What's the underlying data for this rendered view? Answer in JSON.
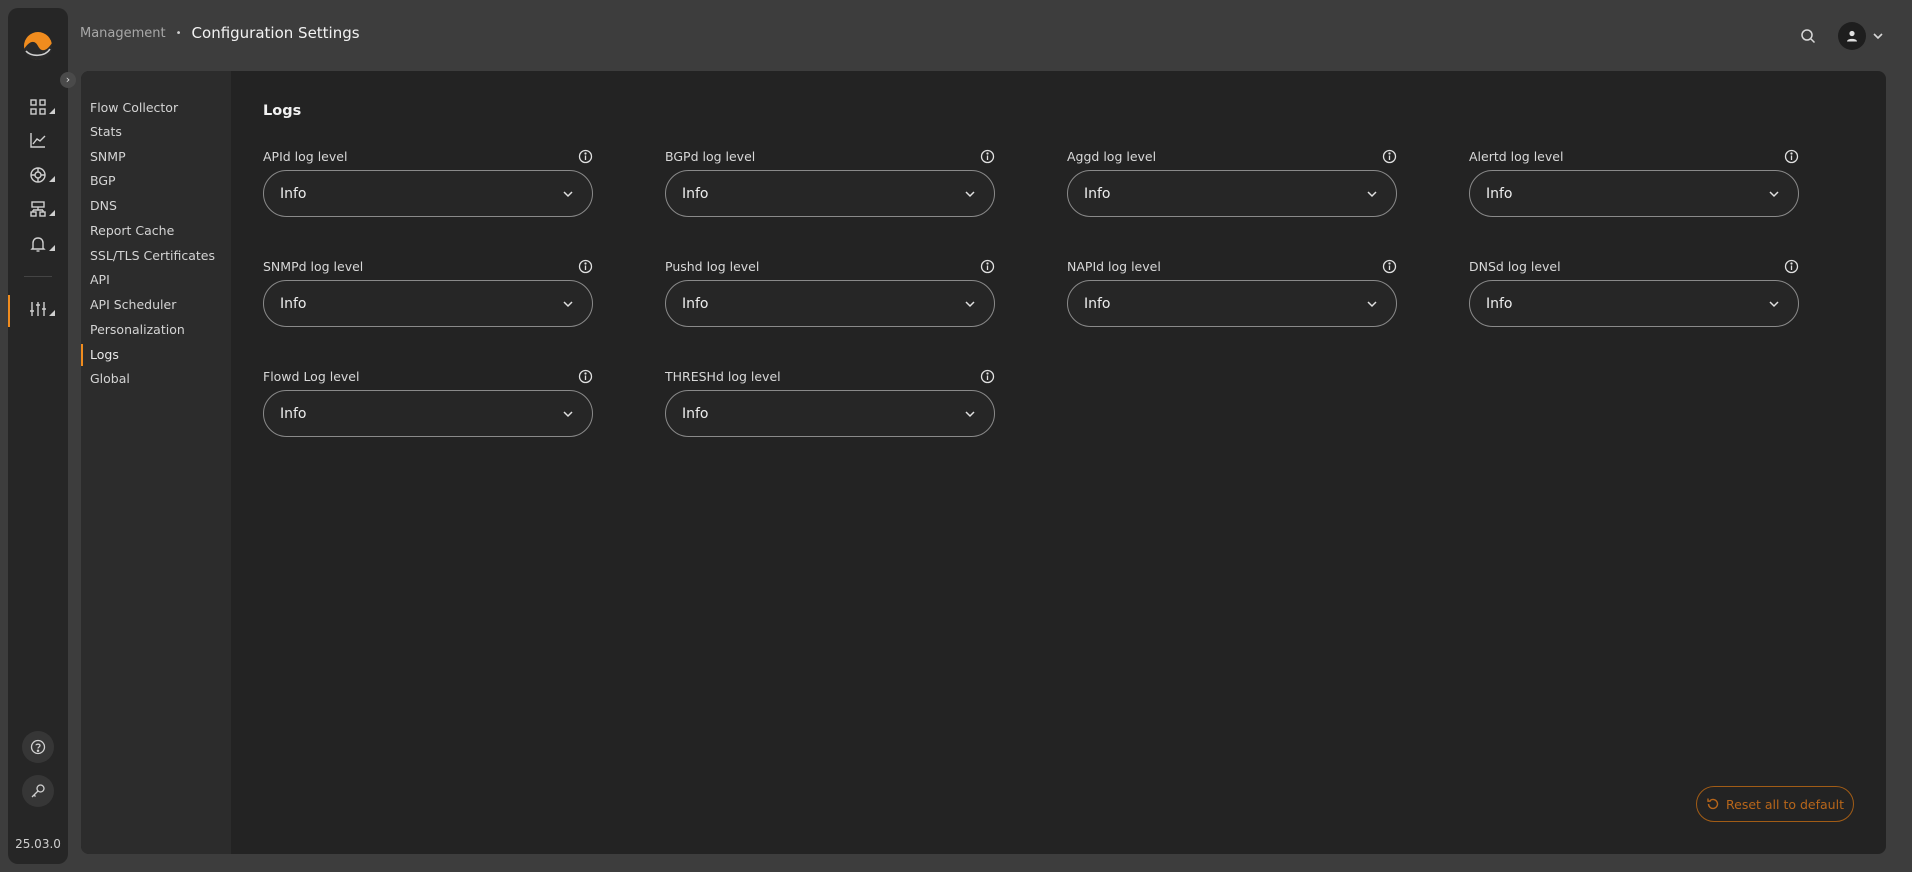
{
  "app": {
    "version": "25.03.0",
    "accent_color": "#f08c1e"
  },
  "rail": {
    "items": [
      {
        "icon": "dashboard-icon"
      },
      {
        "icon": "chart-line-icon"
      },
      {
        "icon": "target-icon"
      },
      {
        "icon": "sitemap-icon"
      },
      {
        "icon": "bell-icon"
      },
      {
        "icon": "sliders-icon",
        "active": true
      }
    ],
    "bottom": [
      {
        "icon": "help-icon"
      },
      {
        "icon": "key-icon"
      }
    ]
  },
  "breadcrumb": {
    "parent": "Management",
    "separator": "•",
    "current": "Configuration Settings"
  },
  "header": {
    "search_icon": "search-icon",
    "user_icon": "user-icon"
  },
  "subnav": {
    "items": [
      {
        "label": "Flow Collector"
      },
      {
        "label": "Stats"
      },
      {
        "label": "SNMP"
      },
      {
        "label": "BGP"
      },
      {
        "label": "DNS"
      },
      {
        "label": "Report Cache"
      },
      {
        "label": "SSL/TLS Certificates"
      },
      {
        "label": "API"
      },
      {
        "label": "API Scheduler"
      },
      {
        "label": "Personalization"
      },
      {
        "label": "Logs",
        "active": true
      },
      {
        "label": "Global"
      }
    ]
  },
  "section": {
    "title": "Logs",
    "fields": [
      {
        "label": "APId log level",
        "value": "Info"
      },
      {
        "label": "BGPd log level",
        "value": "Info"
      },
      {
        "label": "Aggd log level",
        "value": "Info"
      },
      {
        "label": "Alertd log level",
        "value": "Info"
      },
      {
        "label": "SNMPd log level",
        "value": "Info"
      },
      {
        "label": "Pushd log level",
        "value": "Info"
      },
      {
        "label": "NAPId log level",
        "value": "Info"
      },
      {
        "label": "DNSd log level",
        "value": "Info"
      },
      {
        "label": "Flowd Log level",
        "value": "Info"
      },
      {
        "label": "THRESHd log level",
        "value": "Info"
      }
    ]
  },
  "actions": {
    "reset_label": "Reset all to default"
  }
}
